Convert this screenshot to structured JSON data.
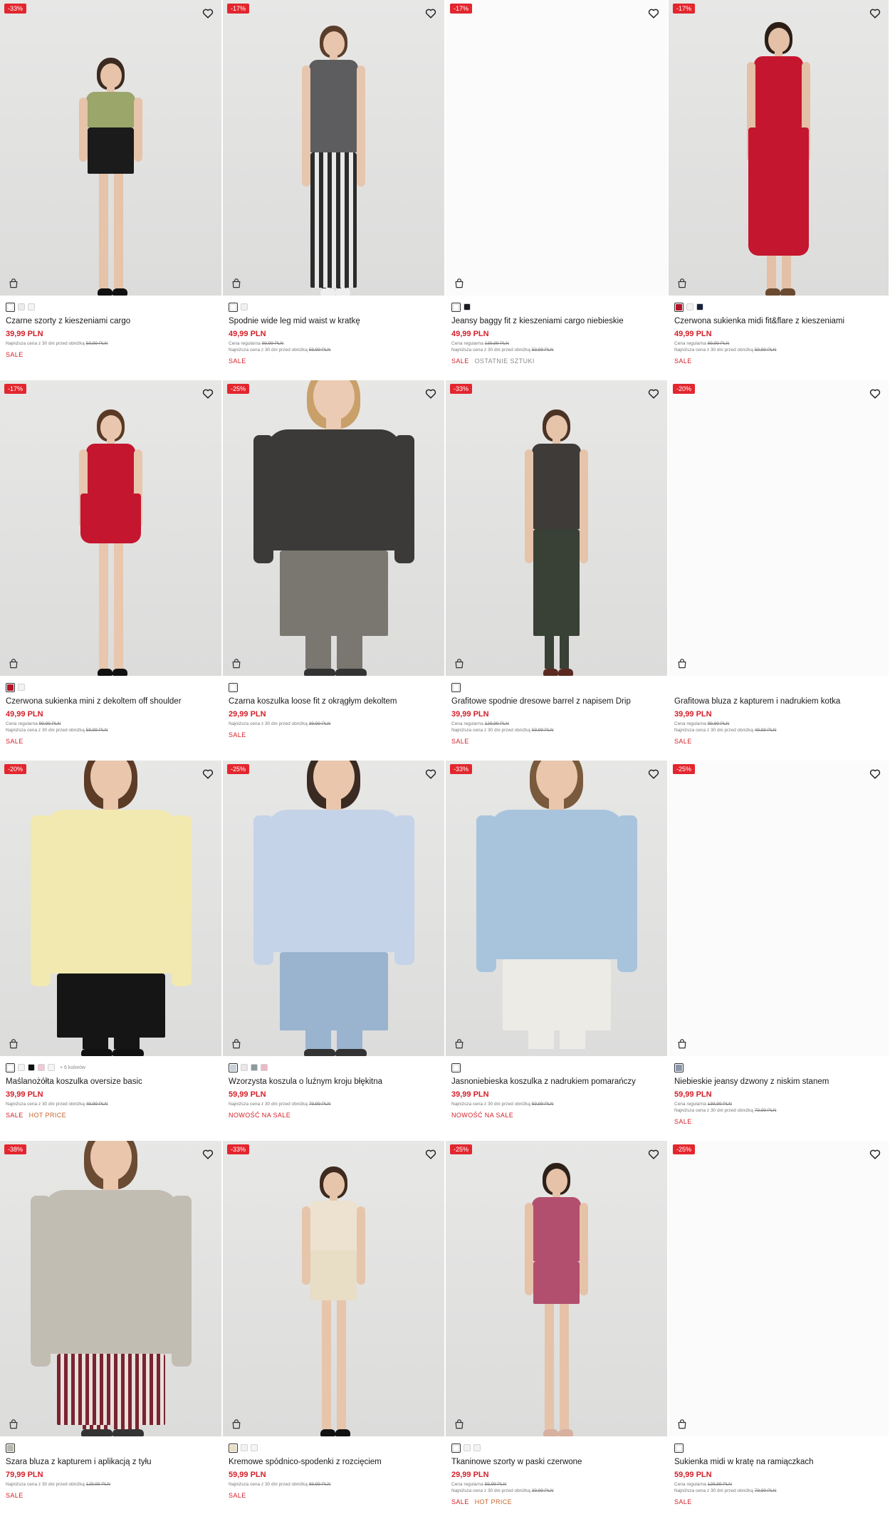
{
  "colors": {
    "sale_red": "#e3262e",
    "price_red": "#d4202a",
    "hot_orange": "#c6642c"
  },
  "products": [
    {
      "badge": "-33%",
      "name": "Czarne szorty z kieszeniami cargo",
      "price": "39,99 PLN",
      "regular_label": "",
      "regular_price": "",
      "lowest_label": "Najniższa cena z 30 dni przed obniżką",
      "lowest_price": "59,99 PLN",
      "tags": [
        "SALE"
      ],
      "swatches": [
        "#ffffff",
        "#ececec",
        "#f4f4f4"
      ],
      "active_swatch": 0,
      "more_colors": "",
      "image": "model-green-top-black-shorts"
    },
    {
      "badge": "-17%",
      "name": "Spodnie wide leg mid waist w kratkę",
      "price": "49,99 PLN",
      "regular_label": "Cena regularna",
      "regular_price": "99,99 PLN",
      "lowest_label": "Najniższa cena z 30 dni przed obniżką",
      "lowest_price": "59,99 PLN",
      "tags": [
        "SALE"
      ],
      "swatches": [
        "#ffffff",
        "#f0f0f0"
      ],
      "active_swatch": 0,
      "more_colors": "",
      "image": "model-grey-jacket-plaid-pants"
    },
    {
      "badge": "-17%",
      "name": "Jeansy baggy fit z kieszeniami cargo niebieskie",
      "price": "49,99 PLN",
      "regular_label": "Cena regularna",
      "regular_price": "139,99 PLN",
      "lowest_label": "Najniższa cena z 30 dni przed obniżką",
      "lowest_price": "59,99 PLN",
      "tags": [
        "SALE",
        "OSTATNIE SZTUKI"
      ],
      "swatches": [
        "#ffffff",
        "#1c1c22"
      ],
      "active_swatch": 0,
      "more_colors": "",
      "image": ""
    },
    {
      "badge": "-17%",
      "name": "Czerwona sukienka midi fit&flare z kieszeniami",
      "price": "49,99 PLN",
      "regular_label": "Cena regularna",
      "regular_price": "89,99 PLN",
      "lowest_label": "Najniższa cena z 30 dni przed obniżką",
      "lowest_price": "59,99 PLN",
      "tags": [
        "SALE"
      ],
      "swatches": [
        "#b5142a",
        "#f2f2f2",
        "#18213b"
      ],
      "active_swatch": 0,
      "more_colors": "",
      "image": "model-red-midi-dress"
    },
    {
      "badge": "-17%",
      "name": "Czerwona sukienka mini z dekoltem off shoulder",
      "price": "49,99 PLN",
      "regular_label": "Cena regularna",
      "regular_price": "99,99 PLN",
      "lowest_label": "Najniższa cena z 30 dni przed obniżką",
      "lowest_price": "59,99 PLN",
      "tags": [
        "SALE"
      ],
      "swatches": [
        "#b5142a",
        "#f2f2f2"
      ],
      "active_swatch": 0,
      "more_colors": "",
      "image": "model-red-mini-dress"
    },
    {
      "badge": "-25%",
      "name": "Czarna koszulka loose fit z okrągłym dekoltem",
      "price": "29,99 PLN",
      "regular_label": "",
      "regular_price": "",
      "lowest_label": "Najniższa cena z 30 dni przed obniżką",
      "lowest_price": "39,99 PLN",
      "tags": [
        "SALE"
      ],
      "swatches": [
        "#ffffff"
      ],
      "active_swatch": 0,
      "more_colors": "",
      "image": "model-black-tee-jeans"
    },
    {
      "badge": "-33%",
      "name": "Grafitowe spodnie dresowe barrel z napisem Drip",
      "price": "39,99 PLN",
      "regular_label": "Cena regularna",
      "regular_price": "129,99 PLN",
      "lowest_label": "Najniższa cena z 30 dni przed obniżką",
      "lowest_price": "59,99 PLN",
      "tags": [
        "SALE"
      ],
      "swatches": [
        "#ffffff"
      ],
      "active_swatch": 0,
      "more_colors": "",
      "image": "model-graphite-hoodie-joggers"
    },
    {
      "badge": "-20%",
      "name": "Grafitowa bluza z kapturem i nadrukiem kotka",
      "price": "39,99 PLN",
      "regular_label": "Cena regularna",
      "regular_price": "99,99 PLN",
      "lowest_label": "Najniższa cena z 30 dni przed obniżką",
      "lowest_price": "49,99 PLN",
      "tags": [
        "SALE"
      ],
      "swatches": [],
      "active_swatch": -1,
      "more_colors": "",
      "image": ""
    },
    {
      "badge": "-20%",
      "name": "Maślanożółta koszulka oversize basic",
      "price": "39,99 PLN",
      "regular_label": "",
      "regular_price": "",
      "lowest_label": "Najniższa cena z 30 dni przed obniżką",
      "lowest_price": "49,99 PLN",
      "tags": [
        "SALE",
        "HOT PRICE"
      ],
      "swatches": [
        "#ffffff",
        "#f3f3f3",
        "#111111",
        "#f2c8d2",
        "#f4f4f4"
      ],
      "active_swatch": 0,
      "more_colors": "+ 6 kolorów",
      "image": "model-yellow-oversize-tee"
    },
    {
      "badge": "-25%",
      "name": "Wzorzysta koszula o luźnym kroju błękitna",
      "price": "59,99 PLN",
      "regular_label": "",
      "regular_price": "",
      "lowest_label": "Najniższa cena z 30 dni przed obniżką",
      "lowest_price": "79,99 PLN",
      "tags": [
        "NOWOŚĆ NA SALE"
      ],
      "swatches": [
        "#c8cfd8",
        "#e8e8e8",
        "#8d9a9c",
        "#eeb8c6"
      ],
      "active_swatch": 0,
      "more_colors": "",
      "image": "model-blue-shirt-jeans"
    },
    {
      "badge": "-33%",
      "name": "Jasnoniebieska koszulka z nadrukiem pomarańczy",
      "price": "39,99 PLN",
      "regular_label": "",
      "regular_price": "",
      "lowest_label": "Najniższa cena z 30 dni przed obniżką",
      "lowest_price": "59,99 PLN",
      "tags": [
        "NOWOŚĆ NA SALE"
      ],
      "swatches": [
        "#ffffff"
      ],
      "active_swatch": 0,
      "more_colors": "",
      "image": "model-blue-print-tee-back"
    },
    {
      "badge": "-25%",
      "name": "Niebieskie jeansy dzwony z niskim stanem",
      "price": "59,99 PLN",
      "regular_label": "Cena regularna",
      "regular_price": "139,99 PLN",
      "lowest_label": "Najniższa cena z 30 dni przed obniżką",
      "lowest_price": "79,99 PLN",
      "tags": [
        "SALE"
      ],
      "swatches": [
        "#8a97ad"
      ],
      "active_swatch": 0,
      "more_colors": "",
      "image": ""
    },
    {
      "badge": "-38%",
      "name": "Szara bluza z kapturem i aplikacją z tyłu",
      "price": "79,99 PLN",
      "regular_label": "",
      "regular_price": "",
      "lowest_label": "Najniższa cena z 30 dni przed obniżką",
      "lowest_price": "129,99 PLN",
      "tags": [
        "SALE"
      ],
      "swatches": [
        "#b9b6ad"
      ],
      "active_swatch": 0,
      "more_colors": "",
      "image": "model-grey-hoodie-back"
    },
    {
      "badge": "-33%",
      "name": "Kremowe spódnico-spodenki z rozcięciem",
      "price": "59,99 PLN",
      "regular_label": "",
      "regular_price": "",
      "lowest_label": "Najniższa cena z 30 dni przed obniżką",
      "lowest_price": "89,99 PLN",
      "tags": [
        "SALE"
      ],
      "swatches": [
        "#e9dcc5",
        "#f2f2f2",
        "#f5f5f5"
      ],
      "active_swatch": 0,
      "more_colors": "",
      "image": "model-cream-vest-skirt"
    },
    {
      "badge": "-25%",
      "name": "Tkaninowe szorty w paski czerwone",
      "price": "29,99 PLN",
      "regular_label": "Cena regularna",
      "regular_price": "59,99 PLN",
      "lowest_label": "Najniższa cena z 30 dni przed obniżką",
      "lowest_price": "39,99 PLN",
      "tags": [
        "SALE",
        "HOT PRICE"
      ],
      "swatches": [
        "#ffffff",
        "#f3f3f3",
        "#f3f3f3"
      ],
      "active_swatch": 0,
      "more_colors": "",
      "image": "model-pink-striped-set"
    },
    {
      "badge": "-25%",
      "name": "Sukienka midi w kratę na ramiączkach",
      "price": "59,99 PLN",
      "regular_label": "Cena regularna",
      "regular_price": "129,99 PLN",
      "lowest_label": "Najniższa cena z 30 dni przed obniżką",
      "lowest_price": "79,99 PLN",
      "tags": [
        "SALE"
      ],
      "swatches": [
        "#ffffff"
      ],
      "active_swatch": 0,
      "more_colors": "",
      "image": ""
    }
  ]
}
